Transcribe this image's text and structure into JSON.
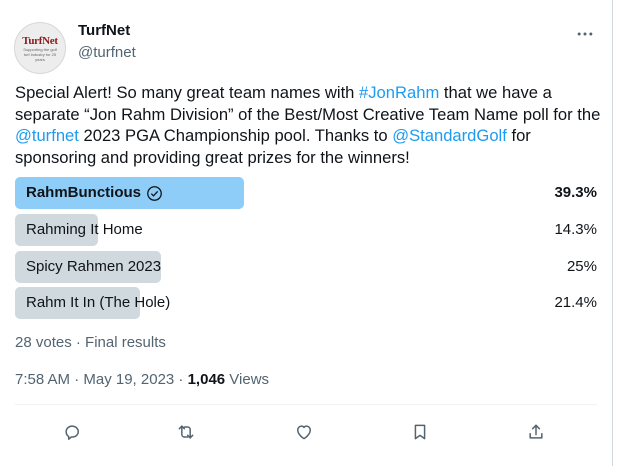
{
  "account": {
    "display_name": "TurfNet",
    "handle": "@turfnet",
    "avatar_logo": "TurfNet",
    "avatar_tagline": "Supporting the golf turf industry for 25 years"
  },
  "tweet": {
    "text_1": "Special Alert! So many great team names with ",
    "mention_hashtag": "#JonRahm",
    "text_2": " that we have a separate “Jon Rahm Division” of the Best/Most Creative Team Name poll for the ",
    "mention_turfnet": "@turfnet",
    "text_3": " 2023 PGA Championship pool. Thanks to ",
    "mention_standard": "@StandardGolf",
    "text_4": " for sponsoring and providing great prizes for the winners!"
  },
  "poll": {
    "options": [
      {
        "label": "RahmBunctious",
        "percent_text": "39.3%",
        "percent": 39.3,
        "winner": true
      },
      {
        "label": "Rahming It Home",
        "percent_text": "14.3%",
        "percent": 14.3,
        "winner": false
      },
      {
        "label": "Spicy Rahmen 2023",
        "percent_text": "25%",
        "percent": 25,
        "winner": false
      },
      {
        "label": "Rahm It In (The Hole)",
        "percent_text": "21.4%",
        "percent": 21.4,
        "winner": false
      }
    ],
    "votes_summary": "28 votes · Final results"
  },
  "meta": {
    "timestamp": "7:58 AM · May 19, 2023 · ",
    "views_count": "1,046",
    "views_label": " Views"
  },
  "actions": [
    "reply-icon",
    "retweet-icon",
    "like-icon",
    "bookmark-icon",
    "share-icon"
  ],
  "colors": {
    "link": "#1d9bf0",
    "winner_bar": "#8ecdf8",
    "bar": "#cfd9de",
    "secondary_text": "#536471"
  }
}
